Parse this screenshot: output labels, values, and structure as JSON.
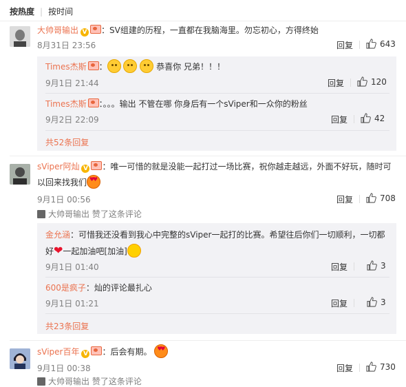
{
  "sort": {
    "hot": "按热度",
    "time": "按时间"
  },
  "labels": {
    "reply": "回复",
    "liked_by_prefix": "赞了这条评论"
  },
  "comments": [
    {
      "author": "大帅哥输出",
      "text": "：SV组建的历程，一直都在我脑海里。勿忘初心，方得终始",
      "time": "8月31日 23:56",
      "likes": "643",
      "replies": [
        {
          "author": "Times杰斯",
          "text": "恭喜你 兄弟！！！",
          "time": "9月1日 21:44",
          "likes": "120"
        },
        {
          "author": "Times杰斯",
          "text": "：。。。输出 不管在哪 你身后有一个sViper和一众你的粉丝",
          "time": "9月2日 22:09",
          "likes": "42"
        }
      ],
      "more": "共52条回复"
    },
    {
      "author": "sViper阿灿",
      "text_line1": "：唯一可惜的就是没能一起打过一场比赛，祝你越走越远，外面不好玩，随时可",
      "text_line2": "以回来找我们",
      "time": "9月1日 00:56",
      "likes": "708",
      "liked_by": "大帅哥输出",
      "replies": [
        {
          "author": "金允涵",
          "text_line1": "：可惜我还没看到我心中完整的sViper一起打的比赛。希望往后你们一切顺利，一切都",
          "text_line2a": "好",
          "text_line2b": "一起加油吧[加油]",
          "time": "9月1日 01:40",
          "likes": "3"
        },
        {
          "author": "600是疯子",
          "text": "：灿的评论最扎心",
          "time": "9月1日 01:21",
          "likes": "3"
        }
      ],
      "more": "共23条回复"
    },
    {
      "author": "sViper百年",
      "text": "：后会有期。",
      "time": "9月1日 00:38",
      "likes": "730",
      "liked_by": "大帅哥输出"
    }
  ]
}
